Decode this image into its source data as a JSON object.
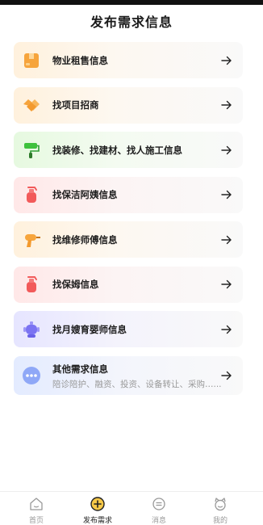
{
  "header": {
    "title": "发布需求信息"
  },
  "items": [
    {
      "label": "物业租售信息",
      "icon": "property-box-icon"
    },
    {
      "label": "找项目招商",
      "icon": "handshake-icon"
    },
    {
      "label": "找装修、找建材、找人施工信息",
      "icon": "paint-roller-icon"
    },
    {
      "label": "找保洁阿姨信息",
      "icon": "spray-bottle-icon"
    },
    {
      "label": "找维修师傅信息",
      "icon": "drill-icon"
    },
    {
      "label": "找保姆信息",
      "icon": "spray-bottle-icon"
    },
    {
      "label": "找月嫂育婴师信息",
      "icon": "baby-robot-icon"
    },
    {
      "label": "其他需求信息",
      "sub": "陪诊陪护、融资、投资、设备转让、采购…...",
      "icon": "more-dots-icon"
    }
  ],
  "tabbar": [
    {
      "label": "首页",
      "icon": "home-icon",
      "active": false
    },
    {
      "label": "发布需求",
      "icon": "publish-plus-icon",
      "active": true
    },
    {
      "label": "消息",
      "icon": "message-icon",
      "active": false
    },
    {
      "label": "我的",
      "icon": "profile-icon",
      "active": false
    }
  ],
  "colors": {
    "accent": "#f7c948",
    "text": "#1d1d1d",
    "muted": "#999999"
  }
}
